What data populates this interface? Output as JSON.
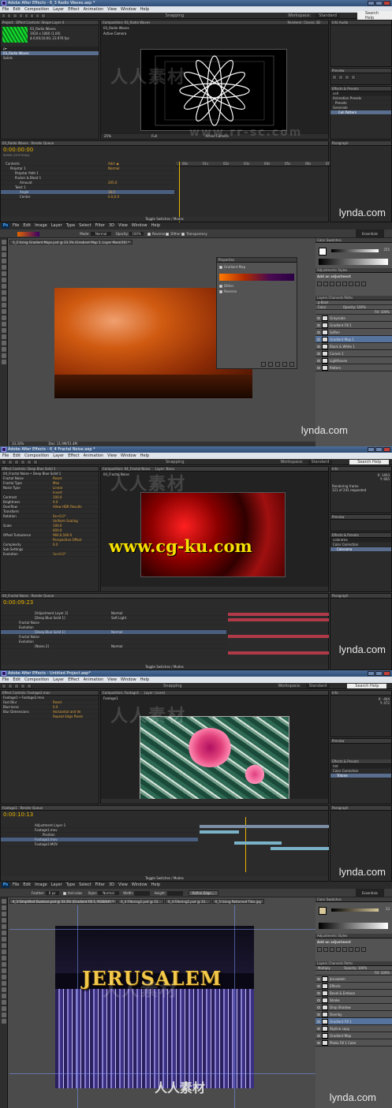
{
  "panel1": {
    "title": "Adobe After Effects - 6_3 Radio Waves.aep *",
    "menu": [
      "File",
      "Edit",
      "Composition",
      "Layer",
      "Effect",
      "Animation",
      "View",
      "Window",
      "Help"
    ],
    "project_tab": "Project",
    "effect_controls_tab": "Effect Controls: Shape Layer 4",
    "project_item_name": "03_Radio Waves",
    "project_item_info": "1920 x 1080 (1.00)",
    "project_item_dur": "Δ 0;00;10;00, 23.976 fps",
    "project_rows": [
      "03_Radio Waves",
      "Solids"
    ],
    "comp_tab": "Composition: 03_Radio Waves",
    "comp_sub": "03_Radio Waves",
    "active_camera": "Active Camera",
    "renderer": "Renderer:",
    "renderer_val": "Classic 3D",
    "workspace_label": "Workspace:",
    "workspace_val": "Standard",
    "search_help": "Search Help",
    "info_tab": "Info",
    "audio_tab": "Audio",
    "preview_tab": "Preview",
    "effects_presets_tab": "Effects & Presets",
    "effects_search": "cell",
    "effects_tree": [
      "Animation Presets",
      "Presets",
      "Generate",
      "Cell Pattern"
    ],
    "timeline_tab": "03_Radio Waves",
    "render_queue_tab": "Render Queue",
    "time": "0:00:00:00",
    "time_sub": "00000 (23.976 fps)",
    "zoom": "25%",
    "res": "Full",
    "layers": [
      {
        "name": "Contents",
        "value": "Add: ◉",
        "indent": 0
      },
      {
        "name": "Polystar 1",
        "value": "Normal",
        "indent": 1
      },
      {
        "name": "Polystar Path 1",
        "value": "",
        "indent": 2
      },
      {
        "name": "Pucker & Bloat 1",
        "value": "",
        "indent": 2
      },
      {
        "name": "Amount",
        "value": "205.0",
        "indent": 3
      },
      {
        "name": "Twist 1",
        "value": "",
        "indent": 2
      },
      {
        "name": "Angle",
        "value": "18.0",
        "indent": 3
      },
      {
        "name": "Center",
        "value": "0.0,0.0",
        "indent": 3
      }
    ],
    "ruler_ticks": [
      "00s",
      "01s",
      "02s",
      "03s",
      "04s",
      "05s",
      "06s",
      "07s"
    ],
    "toggle": "Toggle Switches / Modes",
    "lynda": "lynda.com"
  },
  "panel2": {
    "menu": [
      "File",
      "Edit",
      "Image",
      "Layer",
      "Type",
      "Select",
      "Filter",
      "3D",
      "View",
      "Window",
      "Help"
    ],
    "mode_label": "Mode:",
    "mode_val": "Normal",
    "opacity_label": "Opacity:",
    "opacity_val": "100%",
    "reverse": "Reverse",
    "dither": "Dither",
    "transparency": "Transparency",
    "essentials": "Essentials",
    "doc_tab": "3_2 Using Gradient Maps.psd @ 33.3% (Gradient Map 1, Layer Mask/16) *",
    "properties_title": "Properties",
    "gradient_map": "Gradient Map",
    "dither_chk": "Dither",
    "reverse_chk": "Reverse",
    "color_tab": "Color",
    "swatches_tab": "Swatches",
    "color_value": "255",
    "adjustments_tab": "Adjustments",
    "styles_tab": "Styles",
    "add_adjustment": "Add an adjustment",
    "layers_tab": "Layers",
    "channels_tab": "Channels",
    "paths_tab": "Paths",
    "kind": "ρ Kind",
    "blend_mode": "Color",
    "opacity2_label": "Opacity:",
    "opacity2_val": "100%",
    "fill_label": "Fill:",
    "fill_val": "100%",
    "ps_layers": [
      "Grayscale",
      "Gradient Fill 1",
      "Soften",
      "Gradient Map 1",
      "Black & White 1",
      "Curves 1",
      "Lighthouse",
      "Pattern"
    ],
    "status": "33.33%",
    "status_doc": "Doc: 11.9M/51.4M",
    "lynda": "lynda.com"
  },
  "panel3": {
    "title": "Adobe After Effects - 6_4 Fractal Noise.aep *",
    "menu": [
      "File",
      "Edit",
      "Composition",
      "Layer",
      "Effect",
      "Animation",
      "View",
      "Window",
      "Help"
    ],
    "effect_controls_tab": "Effect Controls: Deep Blue Solid 1",
    "ec_sub": "04_Fractal Noise • Deep Blue Solid 1",
    "ec_rows": [
      {
        "name": "Fractal Noise",
        "value": "Reset"
      },
      {
        "name": "Fractal Type",
        "value": "Max"
      },
      {
        "name": "Noise Type",
        "value": "Linear"
      },
      {
        "name": "",
        "value": "Invert"
      },
      {
        "name": "Contrast",
        "value": "100.0"
      },
      {
        "name": "Brightness",
        "value": "0.0"
      },
      {
        "name": "Overflow",
        "value": "Allow HDR Results"
      },
      {
        "name": "Transform",
        "value": ""
      },
      {
        "name": "Rotation",
        "value": "0x+0.0°"
      },
      {
        "name": "",
        "value": "Uniform Scaling"
      },
      {
        "name": "Scale",
        "value": "100.0"
      },
      {
        "name": "",
        "value": "600.0"
      },
      {
        "name": "Offset Turbulence",
        "value": "960.0,540.0"
      },
      {
        "name": "",
        "value": "Perspective Offset"
      },
      {
        "name": "Complexity",
        "value": "6.0"
      },
      {
        "name": "Sub Settings",
        "value": ""
      },
      {
        "name": "Evolution",
        "value": "1x+0.0°"
      }
    ],
    "comp_tab": "Composition: 04_Fractal Noise",
    "layer_tab": "Layer: None",
    "comp_sub": "04_Fractal Noise",
    "workspace_label": "Workspace:",
    "workspace_val": "Standard",
    "search_help": "Search Help",
    "info_lines": [
      "X: 1403",
      "Y: 605"
    ],
    "rendering": "Rendering frame",
    "rendering_sub": "121 of 241 requested",
    "preview_tab": "Preview",
    "effects_presets_tab": "Effects & Presets",
    "effects_search": "colorama",
    "effects_tree": [
      "Color Correction",
      "Colorama"
    ],
    "timeline_tab": "04_Fractal Noise",
    "render_queue_tab": "Render Queue",
    "time": "0:00:09:23",
    "layers": [
      "[Adjustment Layer 2]",
      "[Deep Blue Solid 1]",
      "Fractal Noise",
      "Evolution",
      "[Deep Blue Solid 1]",
      "Fractal Noise",
      "Evolution",
      "[Noise 2]"
    ],
    "modes": [
      "Normal",
      "Soft Light",
      "",
      "",
      "Normal",
      "",
      "",
      "Normal"
    ],
    "toggle": "Toggle Switches / Modes",
    "watermark": "www.cg-ku.com",
    "lynda": "lynda.com"
  },
  "panel4": {
    "title": "Adobe After Effects - Untitled Project.aep*",
    "menu": [
      "File",
      "Edit",
      "Composition",
      "Layer",
      "Effect",
      "Animation",
      "View",
      "Window",
      "Help"
    ],
    "effect_controls_tab": "Effect Controls: Footage2.mov",
    "ec_sub": "Footage1 • Footage2.mov",
    "ec_rows": [
      {
        "name": "Fast Blur",
        "value": "Reset"
      },
      {
        "name": "Blurriness",
        "value": "0.0"
      },
      {
        "name": "Blur Dimensions",
        "value": "Horizontal and Ve"
      },
      {
        "name": "",
        "value": "Repeat Edge Pixels"
      }
    ],
    "comp_tab": "Composition: Footage1",
    "layer_tab": "Layer: (none)",
    "comp_sub": "Footage1",
    "workspace_label": "Workspace:",
    "workspace_val": "Standard",
    "search_help": "Search Help",
    "info_lines": [
      "X: -444",
      "Y: 472"
    ],
    "effects_search": "tint",
    "effects_tree": [
      "Color Correction",
      "Tritone"
    ],
    "timeline_tab": "Footage1",
    "render_queue_tab": "Render Queue",
    "time": "0:00:10:13",
    "layers": [
      "Adjustment Layer 1",
      "Footage1.mov",
      "Position",
      "Footage2.mov",
      "Footage3.MOV"
    ],
    "toggle": "Toggle Switches / Modes",
    "lynda": "lynda.com"
  },
  "panel5": {
    "menu": [
      "File",
      "Edit",
      "Image",
      "Layer",
      "Type",
      "Select",
      "Filter",
      "3D",
      "View",
      "Window",
      "Help"
    ],
    "feather_label": "Feather:",
    "feather_val": "0 px",
    "anti_alias": "Anti-alias",
    "style_label": "Style:",
    "style_val": "Normal",
    "width_label": "Width:",
    "height_label": "Height:",
    "refine_edge": "Refine Edge...",
    "essentials": "Essentials",
    "doc_tabs": [
      "4_3 Simplified Duotone.psd @ 33.3% (Gradient Fill 1, RGB/8#) *",
      "6_4 Filtering2.psd @ 33...",
      "6_4 Filtering2.psd @ 33...",
      "6_5 Using Patterned Tiles.jpg"
    ],
    "headline": "JERUSALEM",
    "color_tab": "Color",
    "swatches_tab": "Swatches",
    "color_value": "33",
    "adjustments_tab": "Adjustments",
    "styles_tab": "Styles",
    "add_adjustment": "Add an adjustment",
    "layers_tab": "Layers",
    "channels_tab": "Channels",
    "paths_tab": "Paths",
    "blend_mode": "Multiply",
    "opacity_label": "Opacity:",
    "opacity_val": "100%",
    "fill_label": "Fill:",
    "fill_val": "100%",
    "ps_layers": [
      "Jerusalem",
      "Effects",
      "Bevel & Emboss",
      "Stroke",
      "Drop Shadow",
      "Overlay",
      "Gradient Fill 1",
      "Skyline copy",
      "Gradient Map",
      "Photo Fill 1 Color"
    ],
    "watermark_bottom": "人人素材",
    "lynda": "lynda.com"
  },
  "watermark_cn": "人人素材",
  "watermark_url": "www.rr-sc.com"
}
